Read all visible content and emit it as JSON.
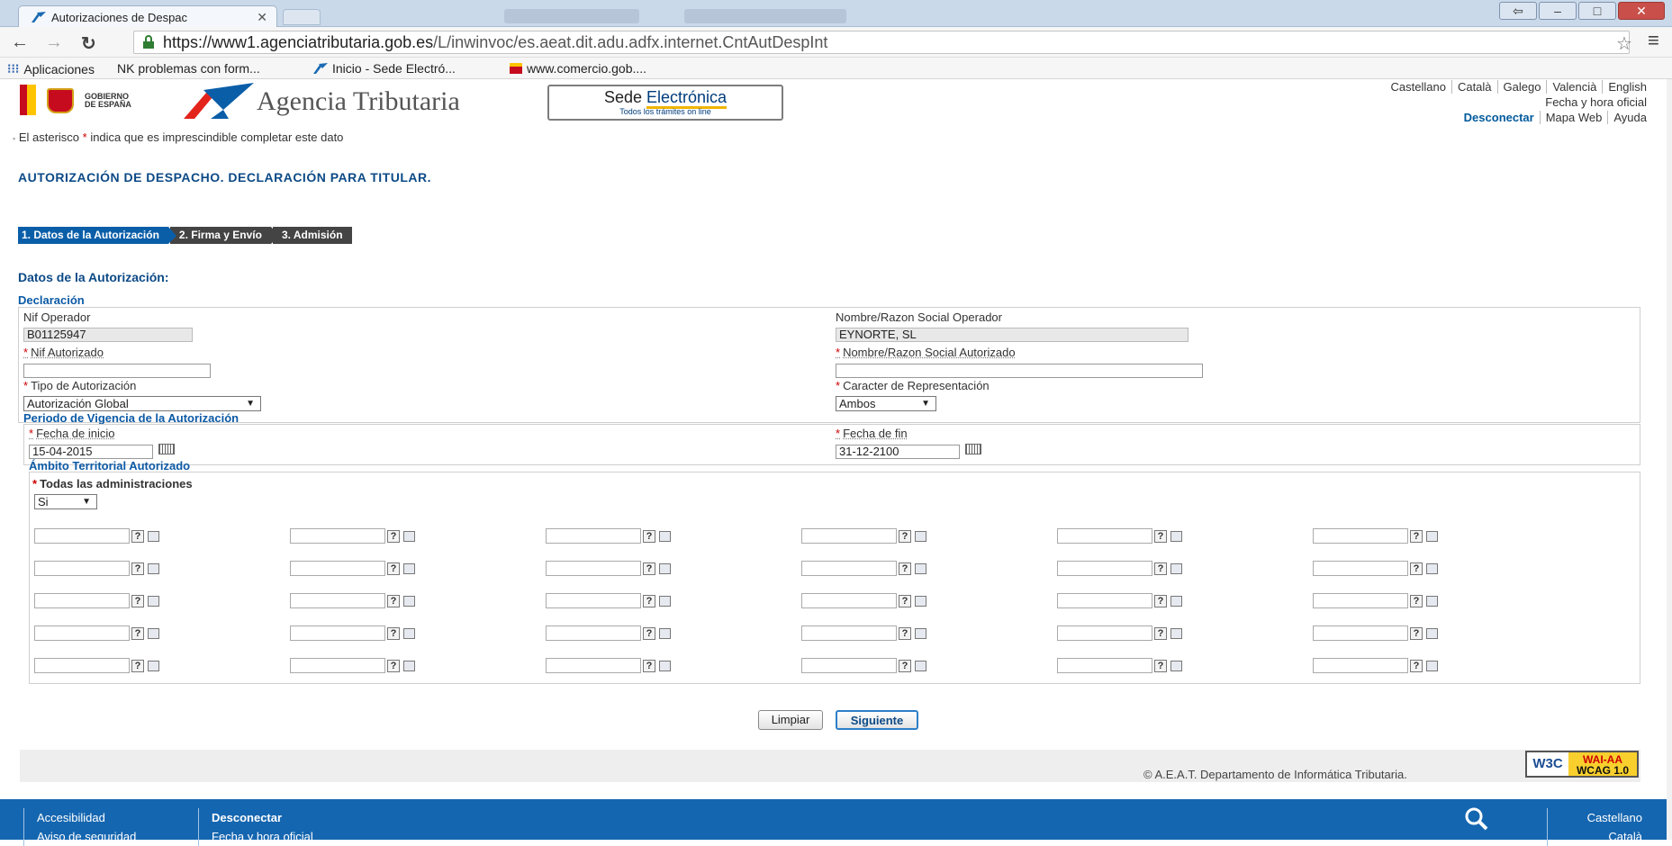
{
  "browser": {
    "tab_title": "Autorizaciones de Despac",
    "url_host": "https://www1.agenciatributaria.gob.es",
    "url_path": "/L/inwinvoc/es.aeat.dit.adu.adfx.internet.CntAutDespInt",
    "bookmarks": [
      {
        "icon": "apps-grid-icon",
        "label": "Aplicaciones"
      },
      {
        "icon": "nk-icon",
        "label": "NK problemas con form..."
      },
      {
        "icon": "aeat-icon",
        "label": "Inicio - Sede Electró..."
      },
      {
        "icon": "comercio-icon",
        "label": "www.comercio.gob...."
      }
    ]
  },
  "header": {
    "gobierno": "GOBIERNO",
    "de_espana": "DE ESPAÑA",
    "agency": "Agencia Tributaria",
    "sede_main": "Sede ",
    "sede_em": "Electrónica",
    "sede_sub": "Todos los trámites on line",
    "languages": [
      "Castellano",
      "Català",
      "Galego",
      "Valencià",
      "English"
    ],
    "fecha_hora": "Fecha y hora oficial",
    "desconectar": "Desconectar",
    "mapa_web": "Mapa Web",
    "ayuda": "Ayuda"
  },
  "note": {
    "before": "El asterisco ",
    "star": "*",
    "after": " indica que es imprescindible completar este dato"
  },
  "page_title": "AUTORIZACIÓN DE DESPACHO. DECLARACIÓN PARA TITULAR.",
  "steps": [
    "1. Datos de la Autorización",
    "2. Firma y Envío",
    "3. Admisión"
  ],
  "section_title": "Datos de la Autorización:",
  "declaracion": {
    "title": "Declaración",
    "nif_operador_label": "Nif Operador",
    "nif_operador_value": "B01125947",
    "nombre_operador_label": "Nombre/Razon Social Operador",
    "nombre_operador_value": "EYNORTE, SL",
    "nif_autorizado_label": "Nif Autorizado",
    "nif_autorizado_value": "",
    "nombre_autorizado_label": "Nombre/Razon Social Autorizado",
    "nombre_autorizado_value": "",
    "tipo_label": "Tipo de Autorización",
    "tipo_value": "Autorización Global",
    "caracter_label": "Caracter de Representación",
    "caracter_value": "Ambos"
  },
  "periodo": {
    "title": "Periodo de Vigencia de la Autorización",
    "inicio_label": "Fecha de inicio",
    "inicio_value": "15-04-2015",
    "fin_label": "Fecha de fin",
    "fin_value": "31-12-2100"
  },
  "ambito": {
    "title": "Ámbito Territorial Autorizado",
    "todas_label": "Todas las administraciones",
    "todas_value": "Si",
    "help_glyph": "?"
  },
  "buttons": {
    "limpiar": "Limpiar",
    "siguiente": "Siguiente"
  },
  "footer": {
    "copyright": "© A.E.A.T. Departamento de Informática Tributaria.",
    "w3c": "W3C",
    "wai": "WAI-AA",
    "wcag": "WCAG 1.0"
  },
  "bottom_bar": {
    "accesibilidad": "Accesibilidad",
    "aviso": "Aviso de seguridad",
    "desconectar": "Desconectar",
    "fecha": "Fecha y hora oficial",
    "castellano": "Castellano",
    "catala": "Català"
  },
  "colors": {
    "brand_blue": "#0c4a86",
    "step_active": "#0a5ea8",
    "bottom_bar": "#1566b0"
  }
}
